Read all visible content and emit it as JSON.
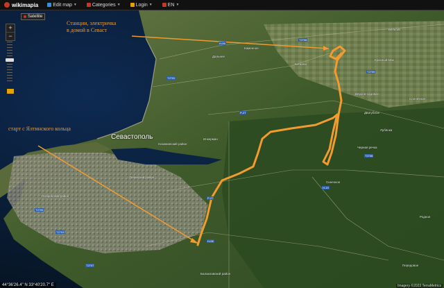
{
  "topbar": {
    "logo": "wikimapia",
    "menu": [
      {
        "label": "Edit map",
        "icon": "pencil-icon",
        "color": "#3a8fd8"
      },
      {
        "label": "Categories",
        "icon": "folder-icon",
        "color": "#c0392b"
      },
      {
        "label": "Login",
        "icon": "user-icon",
        "color": "#e6a300"
      },
      {
        "label": "EN",
        "icon": "flag-icon",
        "color": "#c0392b"
      }
    ]
  },
  "controls": {
    "zoom_in": "+",
    "zoom_out": "−",
    "satellite": "Satellite"
  },
  "annotations": {
    "top_right": "Станции, электричка\nв домой в Севаст",
    "left": "старт с Ялтинского кольца"
  },
  "city": "Севастополь",
  "places": [
    "Дальнее",
    "Каменное",
    "Бечкова",
    "Верхне-садовое",
    "Красный Мак",
    "Бельбек",
    "Двигубное",
    "Лубянка",
    "Солнечное",
    "Синеокое",
    "Инкерман",
    "Черная речка",
    "Родное",
    "Передовое",
    "Нахимовский район",
    "Ленинский район",
    "Балаклавский район",
    "Гагаринский район"
  ],
  "highways": [
    "H-06",
    "T2702",
    "P-27",
    "P-27",
    "H-19",
    "T2708",
    "H-06",
    "T2703",
    "T2705",
    "T2706",
    "T2709",
    "T2707"
  ],
  "coords": "44°36'26.4\" N 33°40'20.7\" E",
  "credit": "Imagery ©2023 TerraMetrics",
  "colors": {
    "route": "#f29b2e",
    "sea": "#0b1e3a",
    "land": "#4a5e2e"
  }
}
